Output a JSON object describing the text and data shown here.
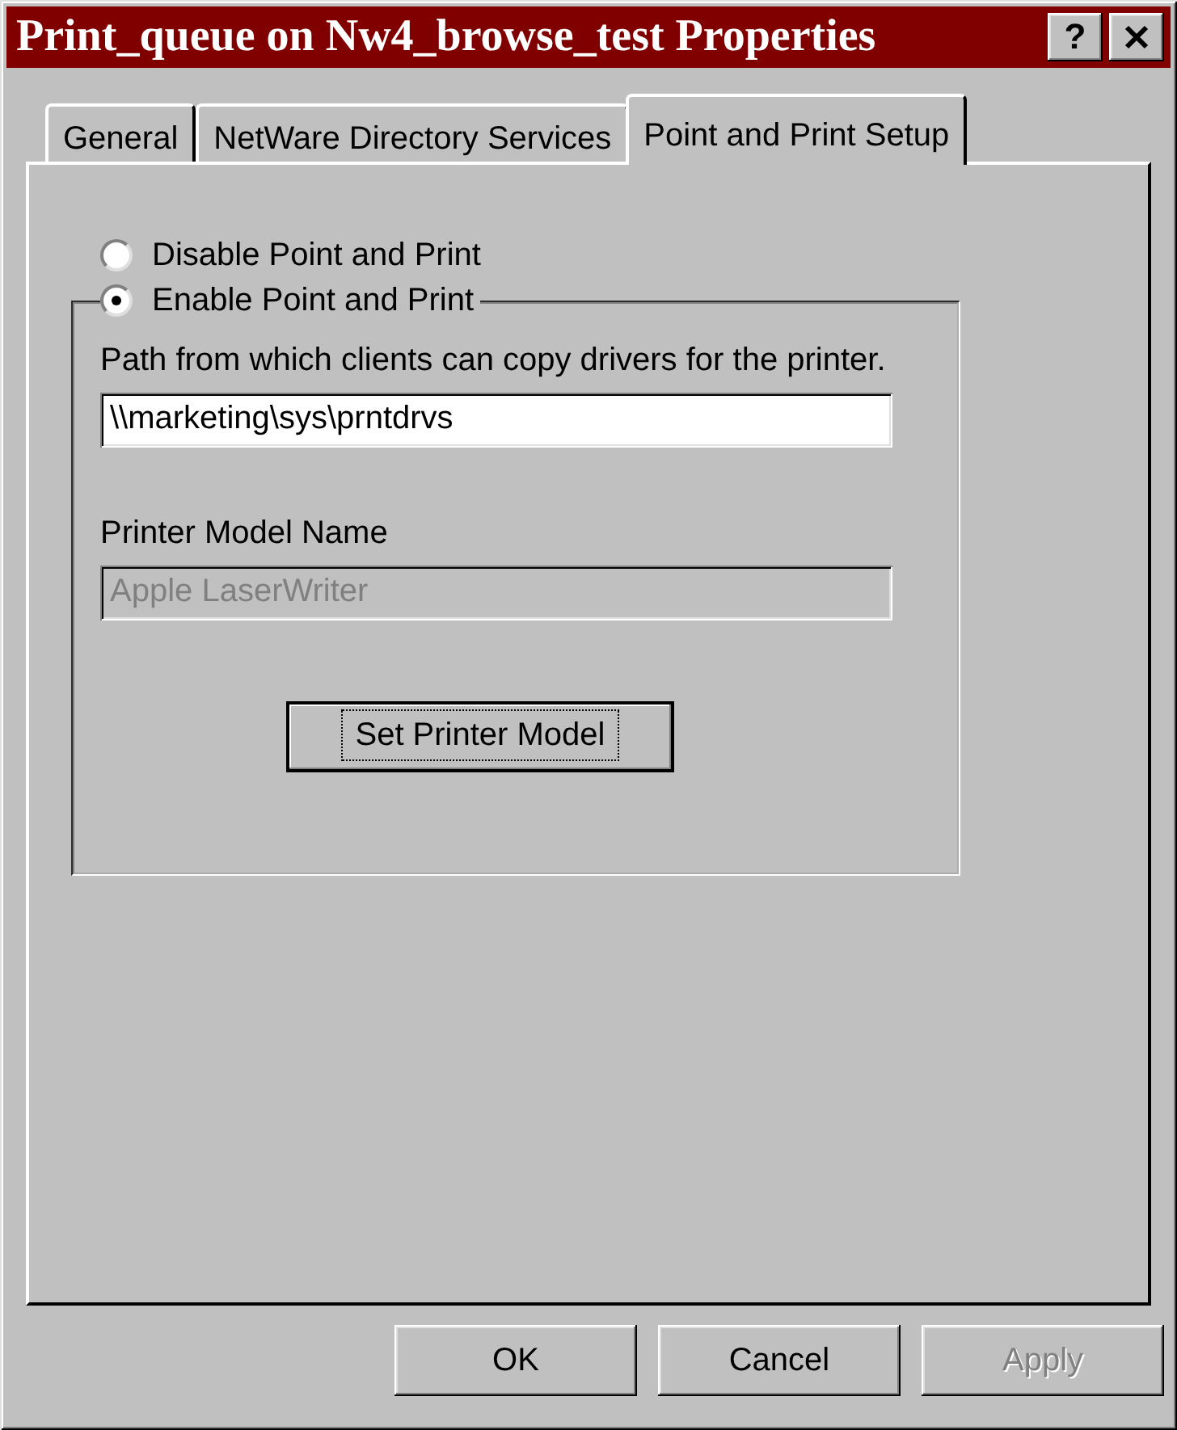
{
  "window": {
    "title": "Print_queue on Nw4_browse_test Properties",
    "help_button": "?"
  },
  "tabs": [
    {
      "label": "General",
      "selected": false
    },
    {
      "label": "NetWare Directory Services",
      "selected": false
    },
    {
      "label": "Point and Print Setup",
      "selected": true
    }
  ],
  "point_and_print": {
    "options": [
      {
        "label": "Disable Point and Print",
        "selected": false
      },
      {
        "label": "Enable Point and Print",
        "selected": true
      }
    ],
    "path_label": "Path from which clients can copy drivers for the printer.",
    "path_value": "\\\\marketing\\sys\\prntdrvs",
    "model_label": "Printer Model Name",
    "model_value": "Apple LaserWriter",
    "model_disabled": true,
    "set_model_button": {
      "label": "Set Printer Model",
      "default": true,
      "focused": true
    }
  },
  "buttons": [
    {
      "label": "OK",
      "disabled": false
    },
    {
      "label": "Cancel",
      "disabled": false
    },
    {
      "label": "Apply",
      "disabled": true
    }
  ]
}
